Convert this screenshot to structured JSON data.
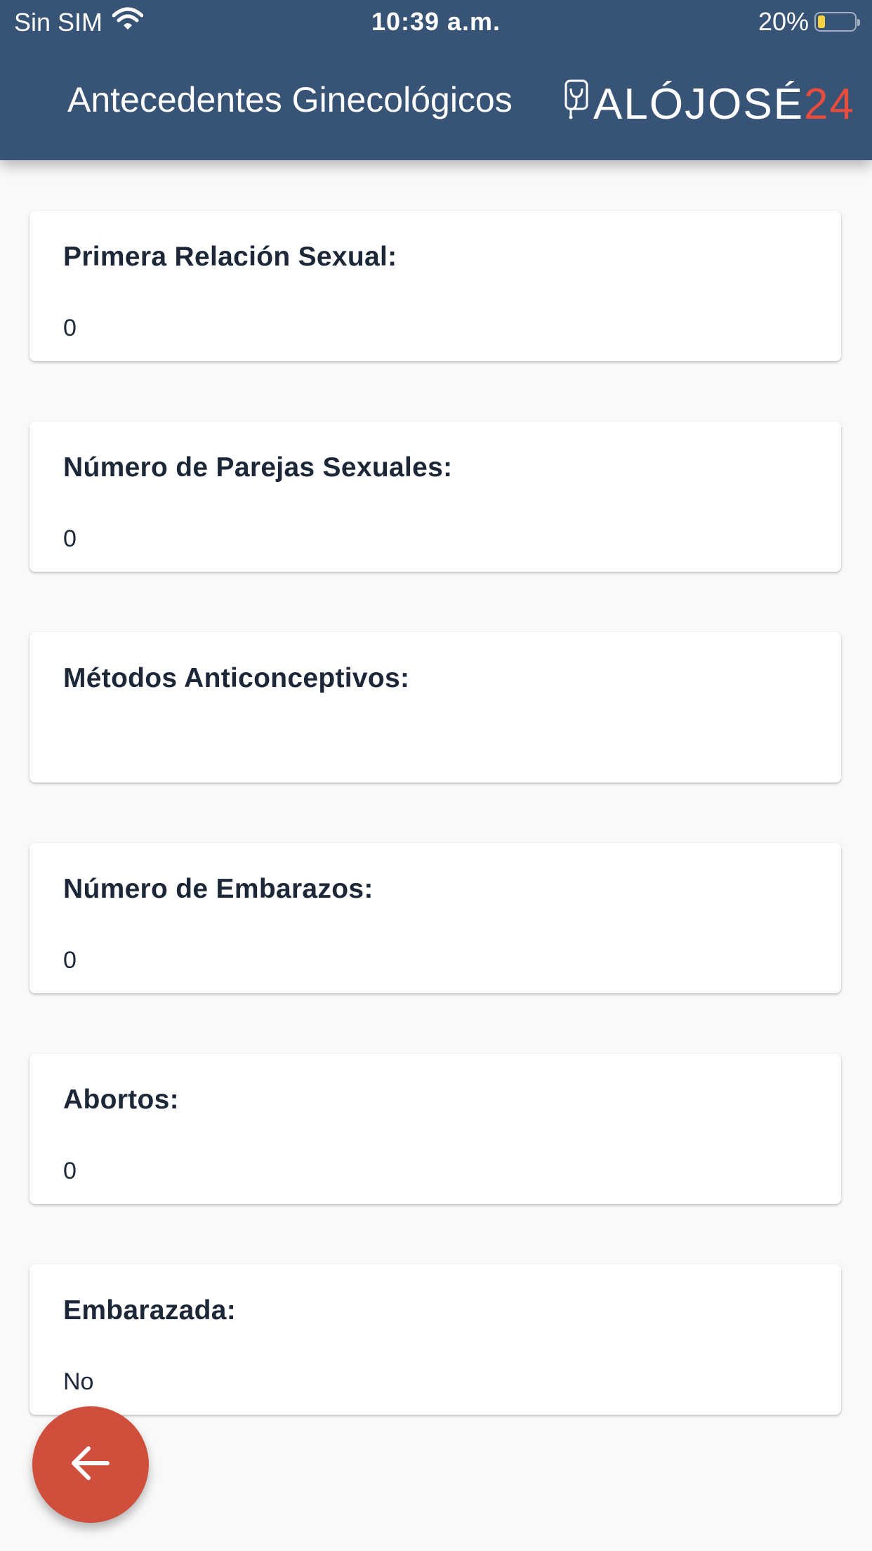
{
  "status_bar": {
    "carrier": "Sin SIM",
    "time": "10:39 a.m.",
    "battery_percent": "20%",
    "battery_level": 0.2,
    "battery_level_color": "#f5d142"
  },
  "header": {
    "title": "Antecedentes Ginecológicos",
    "logo_text": "ALÓJOSÉ",
    "logo_accent": "24",
    "background": "#375375"
  },
  "cards": [
    {
      "label": "Primera Relación Sexual:",
      "value": "0"
    },
    {
      "label": "Número de Parejas Sexuales:",
      "value": "0"
    },
    {
      "label": "Métodos Anticonceptivos:",
      "value": ""
    },
    {
      "label": "Número de Embarazos:",
      "value": "0"
    },
    {
      "label": "Abortos:",
      "value": "0"
    },
    {
      "label": "Embarazada:",
      "value": "No"
    }
  ],
  "fab": {
    "icon": "arrow-left-icon",
    "color": "#cf4e3c"
  }
}
